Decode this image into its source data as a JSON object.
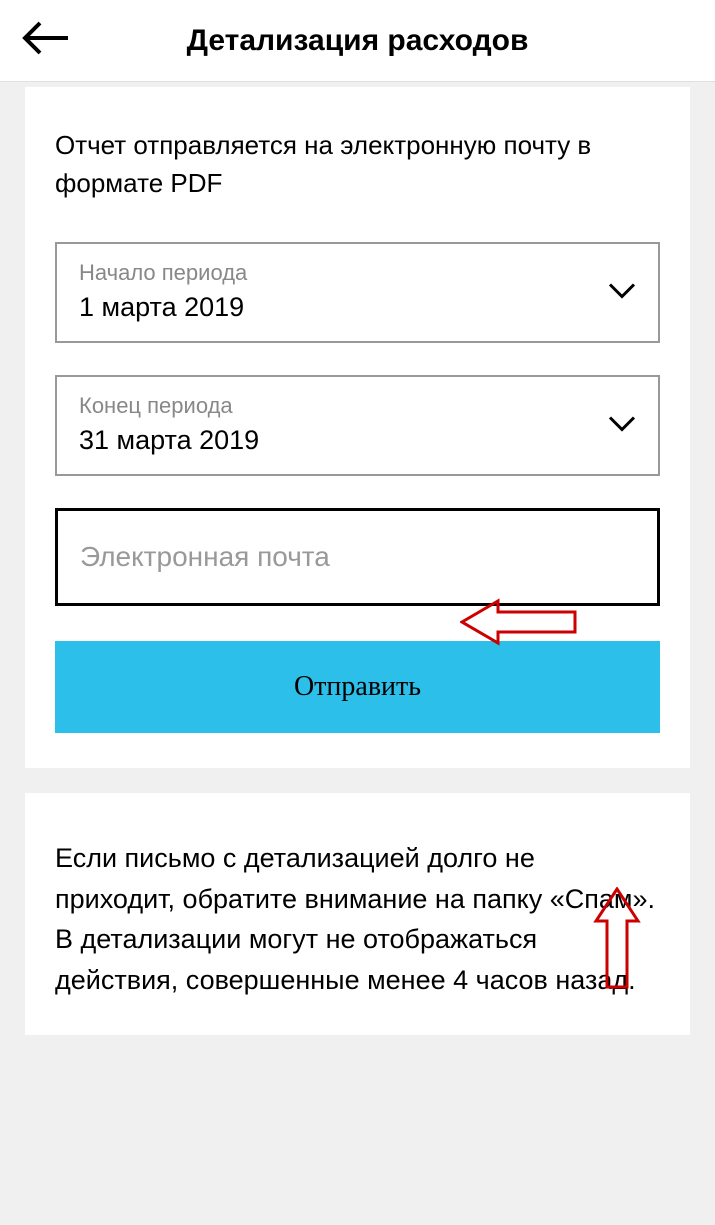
{
  "header": {
    "title": "Детализация расходов"
  },
  "form": {
    "description": "Отчет отправляется на электронную почту в формате PDF",
    "period_start": {
      "label": "Начало периода",
      "value": "1 марта 2019"
    },
    "period_end": {
      "label": "Конец периода",
      "value": "31 марта 2019"
    },
    "email": {
      "placeholder": "Электронная почта",
      "value": ""
    },
    "submit_label": "Отправить"
  },
  "note": {
    "text": "Если письмо с детализацией долго не приходит, обратите внимание на папку «Спам». В детализации могут не отображаться действия, совершенные менее 4 часов назад."
  }
}
